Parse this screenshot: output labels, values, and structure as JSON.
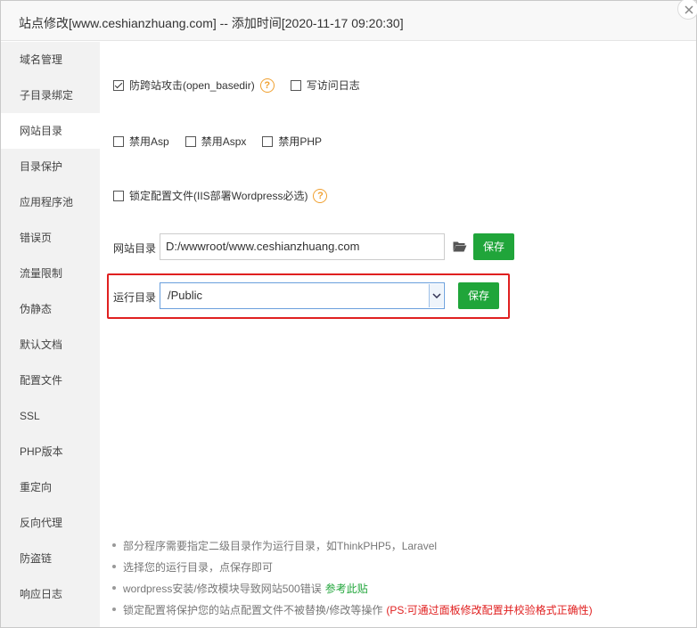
{
  "window": {
    "title": "站点修改[www.ceshianzhuang.com] -- 添加时间[2020-11-17 09:20:30]"
  },
  "sidebar": {
    "items": [
      {
        "label": "域名管理"
      },
      {
        "label": "子目录绑定"
      },
      {
        "label": "网站目录",
        "active": true
      },
      {
        "label": "目录保护"
      },
      {
        "label": "应用程序池"
      },
      {
        "label": "错误页"
      },
      {
        "label": "流量限制"
      },
      {
        "label": "伪静态"
      },
      {
        "label": "默认文档"
      },
      {
        "label": "配置文件"
      },
      {
        "label": "SSL"
      },
      {
        "label": "PHP版本"
      },
      {
        "label": "重定向"
      },
      {
        "label": "反向代理"
      },
      {
        "label": "防盗链"
      },
      {
        "label": "响应日志"
      }
    ]
  },
  "options": {
    "open_basedir": {
      "label": "防跨站攻击(open_basedir)",
      "checked": true
    },
    "access_log": {
      "label": "写访问日志",
      "checked": false
    },
    "disable_asp": {
      "label": "禁用Asp",
      "checked": false
    },
    "disable_aspx": {
      "label": "禁用Aspx",
      "checked": false
    },
    "disable_php": {
      "label": "禁用PHP",
      "checked": false
    },
    "lock_config": {
      "label": "锁定配置文件(IIS部署Wordpress必选)",
      "checked": false
    },
    "help_symbol": "?"
  },
  "site_dir": {
    "label": "网站目录",
    "value": "D:/wwwroot/www.ceshianzhuang.com",
    "save_label": "保存"
  },
  "run_dir": {
    "label": "运行目录",
    "selected": "/Public",
    "save_label": "保存"
  },
  "tips": {
    "items": [
      {
        "text": "部分程序需要指定二级目录作为运行目录，如ThinkPHP5，Laravel"
      },
      {
        "text": "选择您的运行目录，点保存即可"
      },
      {
        "text": "wordpress安装/修改模块导致网站500错误",
        "link": "参考此贴"
      },
      {
        "text": "锁定配置将保护您的站点配置文件不被替换/修改等操作",
        "warning": "(PS:可通过面板修改配置并校验格式正确性)"
      }
    ]
  },
  "colors": {
    "accent_green": "#20a53a",
    "highlight_red": "#e02020",
    "help_orange": "#f0a030"
  }
}
